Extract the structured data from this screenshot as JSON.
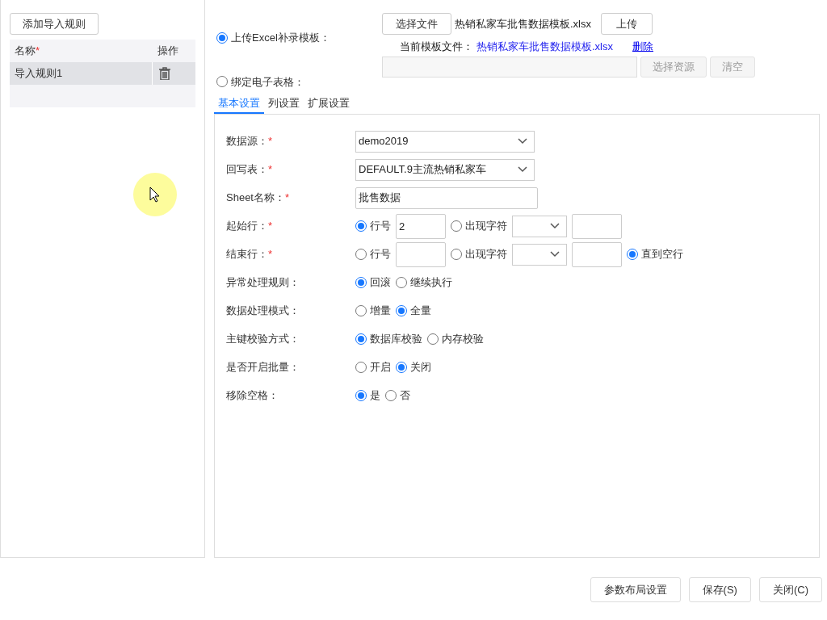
{
  "sidebar": {
    "add_button": "添加导入规则",
    "columns": [
      {
        "label": "名称",
        "required_mark": "*"
      },
      {
        "label": "操作"
      }
    ],
    "rows": [
      {
        "name": "导入规则1",
        "selected": true
      }
    ]
  },
  "source": {
    "options": [
      {
        "label": "上传Excel补录模板：",
        "selected": true
      },
      {
        "label": "绑定电子表格：",
        "selected": false
      }
    ],
    "choose_file_button": "选择文件",
    "file_name": "热销私家车批售数据模板.xlsx",
    "upload_button": "上传",
    "current_label": "当前模板文件：",
    "current_file": "热销私家车批售数据模板.xlsx",
    "delete_link": "删除",
    "resource_buttons": [
      {
        "label": "选择资源",
        "disabled": true
      },
      {
        "label": "清空",
        "disabled": true
      }
    ]
  },
  "tabs": [
    {
      "label": "基本设置",
      "selected": true
    },
    {
      "label": "列设置",
      "selected": false
    },
    {
      "label": "扩展设置",
      "selected": false
    }
  ],
  "form": {
    "rows": [
      {
        "label": "数据源：",
        "required_mark": "*",
        "controls": [
          {
            "kind": "select",
            "value": "demo2019"
          }
        ]
      },
      {
        "label": "回写表：",
        "required_mark": "*",
        "controls": [
          {
            "kind": "select",
            "value": "DEFAULT.9主流热销私家车"
          }
        ]
      },
      {
        "label": "Sheet名称：",
        "required_mark": "*",
        "controls": [
          {
            "kind": "input",
            "value": "批售数据"
          }
        ]
      },
      {
        "label": "起始行：",
        "required_mark": "*",
        "controls": [
          {
            "kind": "radio",
            "label": "行号",
            "selected": true
          },
          {
            "kind": "box",
            "value": "2"
          },
          {
            "kind": "radio",
            "label": "出现字符",
            "selected": false
          },
          {
            "kind": "combo"
          },
          {
            "kind": "box"
          }
        ]
      },
      {
        "label": "结束行：",
        "required_mark": "*",
        "controls": [
          {
            "kind": "radio",
            "label": "行号",
            "selected": false
          },
          {
            "kind": "box"
          },
          {
            "kind": "radio",
            "label": "出现字符",
            "selected": false
          },
          {
            "kind": "combo"
          },
          {
            "kind": "box"
          },
          {
            "kind": "radio",
            "label": "直到空行",
            "selected": true
          }
        ]
      },
      {
        "label": "异常处理规则：",
        "controls": [
          {
            "kind": "radio",
            "label": "回滚",
            "selected": true
          },
          {
            "kind": "radio",
            "label": "继续执行",
            "selected": false
          }
        ]
      },
      {
        "label": "数据处理模式：",
        "controls": [
          {
            "kind": "radio",
            "label": "增量",
            "selected": false
          },
          {
            "kind": "radio",
            "label": "全量",
            "selected": true
          }
        ]
      },
      {
        "label": "主键校验方式：",
        "controls": [
          {
            "kind": "radio",
            "label": "数据库校验",
            "selected": true
          },
          {
            "kind": "radio",
            "label": "内存校验",
            "selected": false
          }
        ]
      },
      {
        "label": "是否开启批量：",
        "controls": [
          {
            "kind": "radio",
            "label": "开启",
            "selected": false
          },
          {
            "kind": "radio",
            "label": "关闭",
            "selected": true
          }
        ]
      },
      {
        "label": "移除空格：",
        "controls": [
          {
            "kind": "radio",
            "label": "是",
            "selected": true
          },
          {
            "kind": "radio",
            "label": "否",
            "selected": false
          }
        ]
      }
    ]
  },
  "footer_buttons": [
    "参数布局设置",
    "保存(S)",
    "关闭(C)"
  ]
}
